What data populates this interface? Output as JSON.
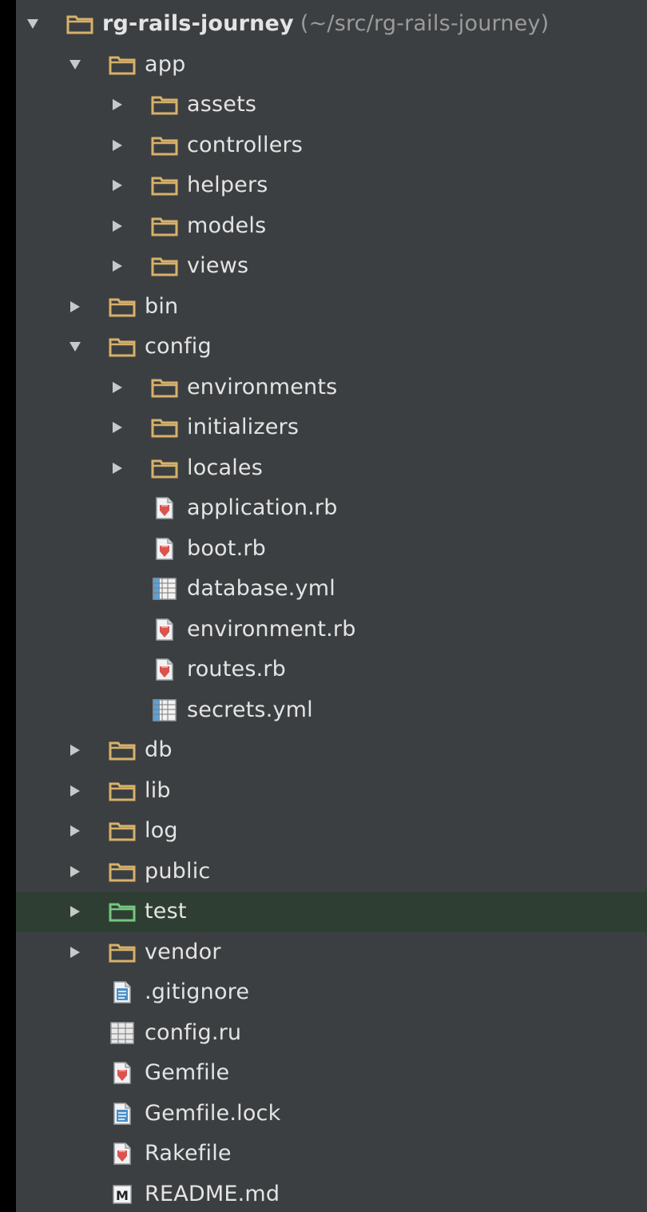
{
  "tree": {
    "items": [
      {
        "name": "rg-rails-journey",
        "path": "(~/src/rg-rails-journey)",
        "depth": 0,
        "kind": "folder",
        "expanded": true,
        "bold": true
      },
      {
        "name": "app",
        "depth": 1,
        "kind": "folder",
        "expanded": true
      },
      {
        "name": "assets",
        "depth": 2,
        "kind": "folder",
        "expanded": false
      },
      {
        "name": "controllers",
        "depth": 2,
        "kind": "folder",
        "expanded": false
      },
      {
        "name": "helpers",
        "depth": 2,
        "kind": "folder",
        "expanded": false
      },
      {
        "name": "models",
        "depth": 2,
        "kind": "folder",
        "expanded": false
      },
      {
        "name": "views",
        "depth": 2,
        "kind": "folder",
        "expanded": false
      },
      {
        "name": "bin",
        "depth": 1,
        "kind": "folder",
        "expanded": false
      },
      {
        "name": "config",
        "depth": 1,
        "kind": "folder",
        "expanded": true
      },
      {
        "name": "environments",
        "depth": 2,
        "kind": "folder",
        "expanded": false
      },
      {
        "name": "initializers",
        "depth": 2,
        "kind": "folder",
        "expanded": false
      },
      {
        "name": "locales",
        "depth": 2,
        "kind": "folder",
        "expanded": false
      },
      {
        "name": "application.rb",
        "depth": 2,
        "kind": "ruby-file"
      },
      {
        "name": "boot.rb",
        "depth": 2,
        "kind": "ruby-file"
      },
      {
        "name": "database.yml",
        "depth": 2,
        "kind": "yaml-file"
      },
      {
        "name": "environment.rb",
        "depth": 2,
        "kind": "ruby-file"
      },
      {
        "name": "routes.rb",
        "depth": 2,
        "kind": "ruby-file"
      },
      {
        "name": "secrets.yml",
        "depth": 2,
        "kind": "yaml-file"
      },
      {
        "name": "db",
        "depth": 1,
        "kind": "folder",
        "expanded": false
      },
      {
        "name": "lib",
        "depth": 1,
        "kind": "folder",
        "expanded": false
      },
      {
        "name": "log",
        "depth": 1,
        "kind": "folder",
        "expanded": false
      },
      {
        "name": "public",
        "depth": 1,
        "kind": "folder",
        "expanded": false
      },
      {
        "name": "test",
        "depth": 1,
        "kind": "test-folder",
        "expanded": false,
        "selected": true
      },
      {
        "name": "vendor",
        "depth": 1,
        "kind": "folder",
        "expanded": false
      },
      {
        "name": ".gitignore",
        "depth": 1,
        "kind": "text-file"
      },
      {
        "name": "config.ru",
        "depth": 1,
        "kind": "config-file"
      },
      {
        "name": "Gemfile",
        "depth": 1,
        "kind": "ruby-file"
      },
      {
        "name": "Gemfile.lock",
        "depth": 1,
        "kind": "text-file"
      },
      {
        "name": "Rakefile",
        "depth": 1,
        "kind": "ruby-file"
      },
      {
        "name": "README.md",
        "depth": 1,
        "kind": "markdown-file"
      }
    ]
  },
  "colors": {
    "panel_background": "#3c3f41",
    "selected_row": "#2f3e33",
    "folder": "#d7b16a",
    "test_folder": "#76c77e",
    "ruby": "#d9534f",
    "yaml": "#4a90c8",
    "text": "#e4e4e4",
    "path_text": "#9b9b9b"
  }
}
